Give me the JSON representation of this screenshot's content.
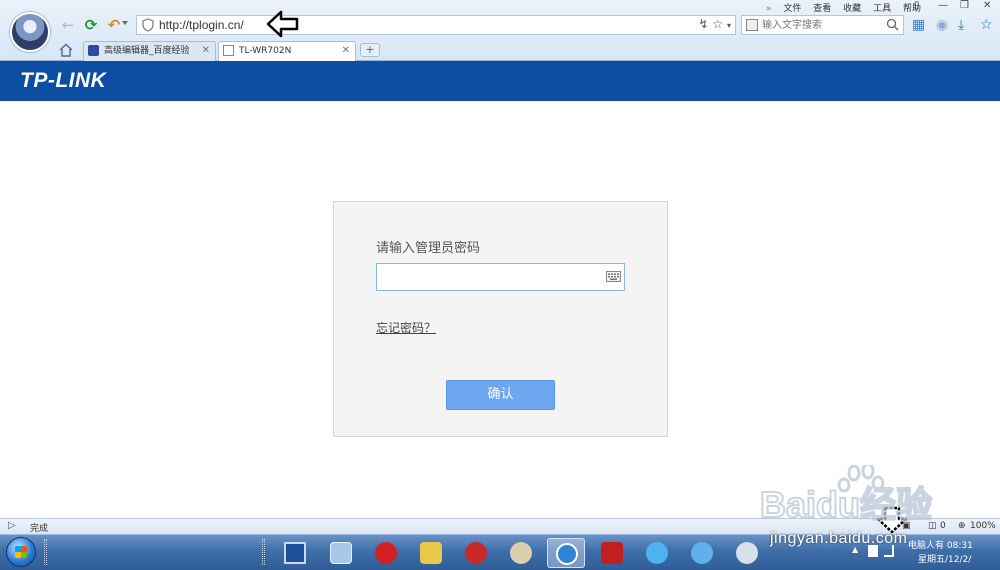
{
  "browser": {
    "address_url": "http://tplogin.cn/",
    "search_placeholder": "输入文字搜索",
    "menu": [
      "文件",
      "查看",
      "收藏",
      "工具",
      "帮助"
    ],
    "tabs": [
      {
        "label": "高级编辑器_百度经验"
      },
      {
        "label": "TL-WR702N"
      }
    ],
    "new_tab_label": "+"
  },
  "page": {
    "brand": "TP-LINK",
    "login_title": "请输入管理员密码",
    "password_value": "",
    "forgot_label": "忘记密码？",
    "confirm_label": "确认",
    "header_color": "#0b4ea2",
    "button_color": "#6ea6f0"
  },
  "status_bar": {
    "status": "完成",
    "count": "0",
    "zoom": "100%"
  },
  "taskbar": {
    "tray_label": "电脑人有",
    "time": "08:31",
    "date": "星期五/12/2/"
  },
  "watermark": {
    "brand": "Baidu经验",
    "url": "jingyan.baidu.com"
  }
}
